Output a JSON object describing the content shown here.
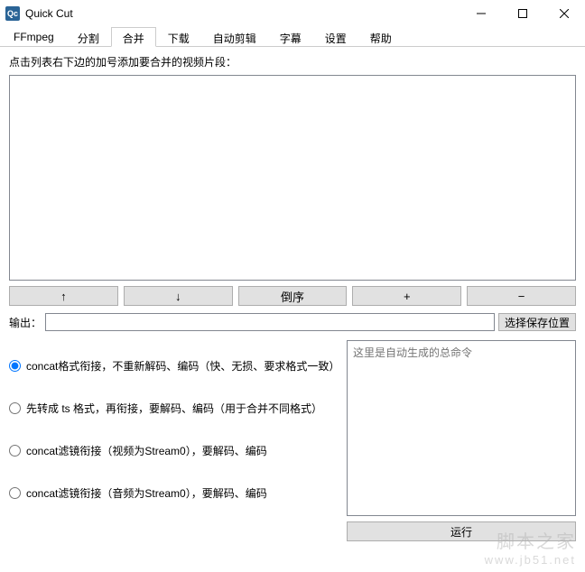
{
  "window": {
    "title": "Quick Cut",
    "icon_text": "Qc"
  },
  "tabs": [
    {
      "label": "FFmpeg",
      "active": false
    },
    {
      "label": "分割",
      "active": false
    },
    {
      "label": "合并",
      "active": true
    },
    {
      "label": "下载",
      "active": false
    },
    {
      "label": "自动剪辑",
      "active": false
    },
    {
      "label": "字幕",
      "active": false
    },
    {
      "label": "设置",
      "active": false
    },
    {
      "label": "帮助",
      "active": false
    }
  ],
  "merge": {
    "instruction": "点击列表右下边的加号添加要合并的视频片段：",
    "buttons": {
      "move_up": "↑",
      "move_down": "↓",
      "reverse": "倒序",
      "add": "+",
      "remove": "−"
    },
    "output_label": "输出：",
    "output_value": "",
    "browse_label": "选择保存位置",
    "radios": [
      {
        "label": "concat格式衔接，不重新解码、编码（快、无损、要求格式一致）",
        "checked": true
      },
      {
        "label": "先转成 ts 格式，再衔接，要解码、编码（用于合并不同格式）",
        "checked": false
      },
      {
        "label": "concat滤镜衔接（视频为Stream0），要解码、编码",
        "checked": false
      },
      {
        "label": "concat滤镜衔接（音频为Stream0），要解码、编码",
        "checked": false
      }
    ],
    "command_placeholder": "这里是自动生成的总命令",
    "run_label": "运行"
  },
  "watermark": {
    "line1": "脚本之家",
    "line2": "www.jb51.net"
  }
}
